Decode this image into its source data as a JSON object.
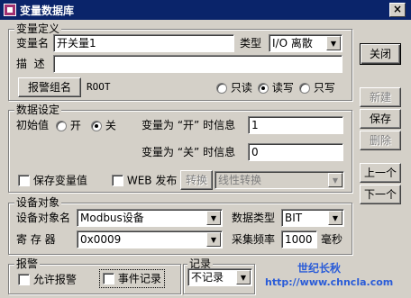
{
  "window": {
    "title": "变量数据库",
    "close_glyph": "×"
  },
  "side_buttons": {
    "close": "关闭",
    "new": "新建",
    "save": "保存",
    "delete": "删除",
    "prev": "上一个",
    "next": "下一个"
  },
  "var_def": {
    "group_title": "变量定义",
    "name_label": "变量名",
    "name_value": "开关量1",
    "type_label": "类型",
    "type_value": "I/O 离散",
    "desc_label": "描  述",
    "desc_value": "",
    "alarm_group_button": "报警组名",
    "alarm_group_value": "ROOT",
    "access": {
      "options": [
        "只读",
        "读写",
        "只写"
      ],
      "selected": "读写"
    }
  },
  "data_setting": {
    "group_title": "数据设定",
    "init_label": "初始值",
    "init_options": [
      "开",
      "关"
    ],
    "init_selected": "关",
    "on_msg_label": "变量为 “开” 时信息",
    "on_msg_value": "1",
    "off_msg_label": "变量为 “关” 时信息",
    "off_msg_value": "0",
    "save_value_label": "保存变量值",
    "web_publish_label": "WEB 发布",
    "convert_label": "转换",
    "convert_value": "线性转换"
  },
  "device": {
    "group_title": "设备对象",
    "object_label": "设备对象名",
    "object_value": "Modbus设备",
    "datatype_label": "数据类型",
    "datatype_value": "BIT",
    "register_label": "寄 存 器",
    "register_value": "0x0009",
    "freq_label": "采集频率",
    "freq_value": "1000",
    "freq_unit": "毫秒"
  },
  "alarm": {
    "group_title": "报警",
    "allow_label": "允许报警",
    "event_label": "事件记录"
  },
  "record": {
    "group_title": "记录",
    "value": "不记录"
  },
  "watermark": {
    "line1": "世纪长秋",
    "line2": "http://www.chncla.com"
  }
}
